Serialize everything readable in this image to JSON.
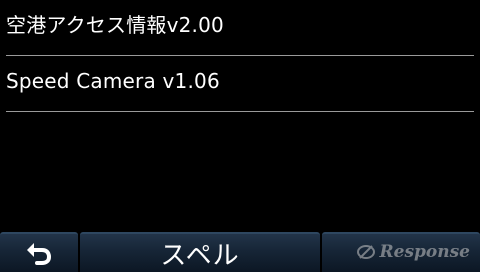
{
  "list": {
    "items": [
      {
        "label": "空港アクセス情報v2.00"
      },
      {
        "label": "Speed Camera v1.06"
      }
    ]
  },
  "toolbar": {
    "back_icon": "back-arrow-icon",
    "spell_label": "スペル"
  },
  "watermark": {
    "text": "Response"
  },
  "colors": {
    "background": "#000000",
    "divider": "#9a9a9a",
    "button_top": "#223449",
    "button_bottom": "#0c1724"
  }
}
